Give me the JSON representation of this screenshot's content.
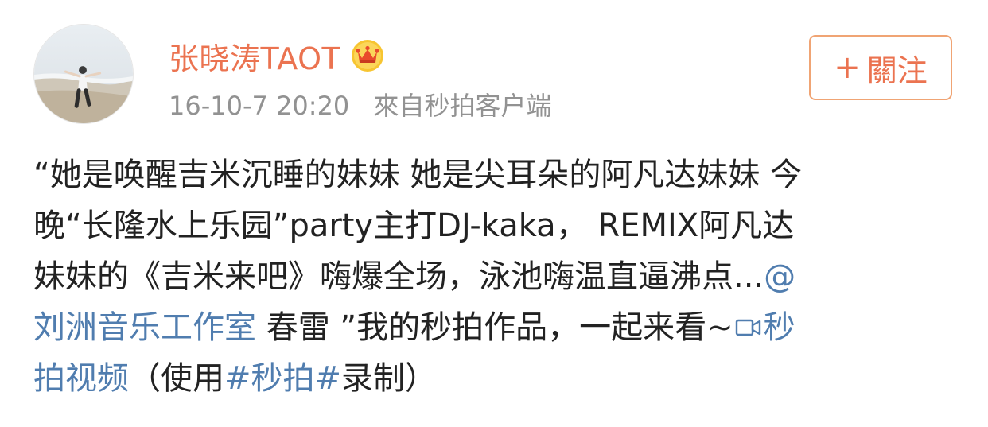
{
  "user": {
    "name": "张晓涛TAOT",
    "badge_icon": "vip-crown-icon",
    "name_color": "#eb7350"
  },
  "meta": {
    "time": "16-10-7 20:20",
    "source": "來自秒拍客户端"
  },
  "follow_button": {
    "plus": "+",
    "label": "關注"
  },
  "post": {
    "line1": "“她是唤醒吉米沉睡的妹妹 她是尖耳朵的阿凡达妹妹 今",
    "line2": "晚“长隆水上乐园”party主打DJ-kaka， REMIX阿凡达",
    "line3_text": "妹妹的《吉米来吧》嗨爆全场，泳池嗨温直逼沸点...",
    "line3_at": "@",
    "line4_mention": "刘洲音乐工作室",
    "line4_text": " 春雷 ”我的秒拍作品，一起来看~",
    "line4_video_icon": "video-camera-icon",
    "line4_video_link_start": "秒",
    "line5_video_link_end": "拍视频",
    "line5_text1": "（使用",
    "line5_hashtag": "#秒拍#",
    "line5_text2": "录制）"
  },
  "colors": {
    "accent": "#eb7350",
    "link": "#507daf",
    "meta_gray": "#929292",
    "text": "#222222"
  }
}
